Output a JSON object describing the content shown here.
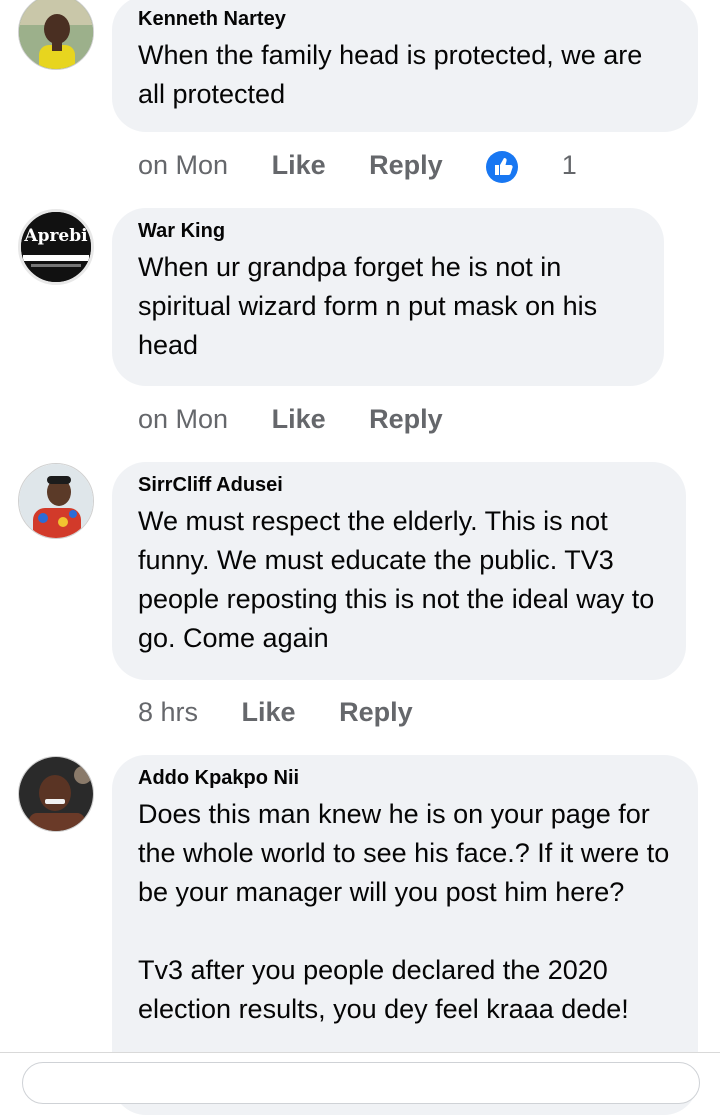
{
  "comments": [
    {
      "author": "Kenneth Nartey",
      "text": "When the family head is protected, we are all protected",
      "time": "on Mon",
      "like_label": "Like",
      "reply_label": "Reply",
      "reaction_count": "1",
      "avatar_icon": "profile-photo"
    },
    {
      "author": "War King",
      "text": "When ur grandpa forget he is not in spiritual wizard form n put mask on his head",
      "time": "on Mon",
      "like_label": "Like",
      "reply_label": "Reply",
      "avatar_logo_text": "Aprebi",
      "avatar_icon": "logo-avatar"
    },
    {
      "author": "SirrCliff Adusei",
      "text": "We must respect the elderly. This is not funny. We must educate the public. TV3 people reposting this is not the ideal way to go. Come again",
      "time": "8 hrs",
      "like_label": "Like",
      "reply_label": "Reply",
      "avatar_icon": "profile-photo"
    },
    {
      "author": "Addo Kpakpo Nii",
      "text": "Does this man knew he is on your page for the whole world to see his face.? If it were to be your manager will you post him here?\n\nTv3 after you people declared the 2020 election results, you dey feel kraaa dede!",
      "avatar_icon": "profile-photo"
    }
  ],
  "colors": {
    "bubble": "#f0f2f5",
    "meta_text": "#65676b",
    "like_blue": "#1877f2"
  }
}
